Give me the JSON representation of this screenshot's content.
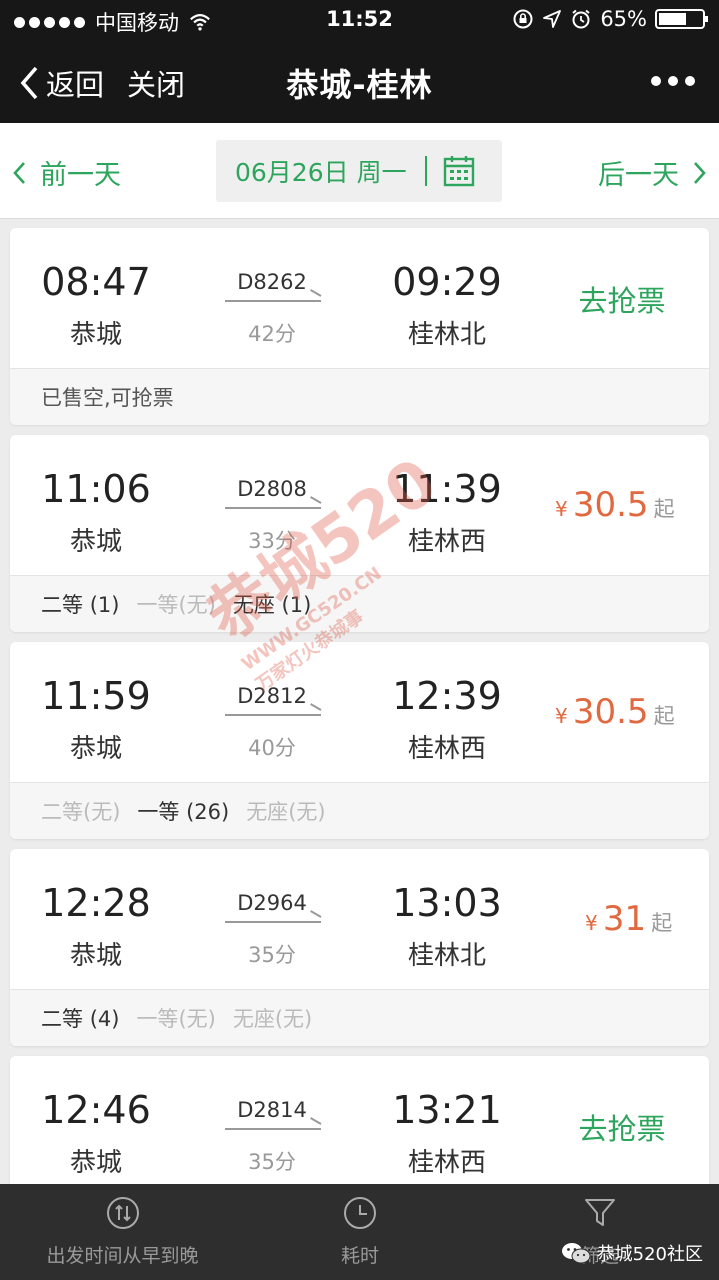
{
  "status_bar": {
    "carrier": "中国移动",
    "time": "11:52",
    "battery_percent": "65%",
    "battery_level": 0.65
  },
  "nav": {
    "back_label": "返回",
    "close_label": "关闭",
    "title": "恭城-桂林"
  },
  "date_bar": {
    "prev_label": "前一天",
    "date": "06月26日 周一",
    "next_label": "后一天"
  },
  "trains": [
    {
      "dep_time": "08:47",
      "dep_station": "恭城",
      "train_no": "D8262",
      "duration": "42分",
      "arr_time": "09:29",
      "arr_station": "桂林北",
      "action": "去抢票",
      "note": "已售空,可抢票"
    },
    {
      "dep_time": "11:06",
      "dep_station": "恭城",
      "train_no": "D2808",
      "duration": "33分",
      "arr_time": "11:39",
      "arr_station": "桂林西",
      "price_symbol": "¥",
      "price": "30.5",
      "price_suffix": "起",
      "seats": [
        {
          "label": "二等",
          "count": "(1)",
          "available": true
        },
        {
          "label": "一等",
          "count": "(无)",
          "available": false
        },
        {
          "label": "无座",
          "count": "(1)",
          "available": true
        }
      ]
    },
    {
      "dep_time": "11:59",
      "dep_station": "恭城",
      "train_no": "D2812",
      "duration": "40分",
      "arr_time": "12:39",
      "arr_station": "桂林西",
      "price_symbol": "¥",
      "price": "30.5",
      "price_suffix": "起",
      "seats": [
        {
          "label": "二等",
          "count": "(无)",
          "available": false
        },
        {
          "label": "一等",
          "count": "(26)",
          "available": true
        },
        {
          "label": "无座",
          "count": "(无)",
          "available": false
        }
      ]
    },
    {
      "dep_time": "12:28",
      "dep_station": "恭城",
      "train_no": "D2964",
      "duration": "35分",
      "arr_time": "13:03",
      "arr_station": "桂林北",
      "price_symbol": "¥",
      "price": "31",
      "price_suffix": "起",
      "seats": [
        {
          "label": "二等",
          "count": "(4)",
          "available": true
        },
        {
          "label": "一等",
          "count": "(无)",
          "available": false
        },
        {
          "label": "无座",
          "count": "(无)",
          "available": false
        }
      ]
    },
    {
      "dep_time": "12:46",
      "dep_station": "恭城",
      "train_no": "D2814",
      "duration": "35分",
      "arr_time": "13:21",
      "arr_station": "桂林西",
      "action": "去抢票"
    }
  ],
  "watermark": {
    "brand": "恭城520",
    "url": "WWW.GC520.CN",
    "slogan": "万家灯火恭城事"
  },
  "bottom_bar": {
    "sort_time_label": "出发时间从早到晚",
    "duration_label": "耗时",
    "filter_label": "筛选",
    "account_name": "恭城520社区"
  },
  "colors": {
    "accent_green": "#2ea55d",
    "price_orange": "#e0693f",
    "bar_dark": "#171717"
  }
}
